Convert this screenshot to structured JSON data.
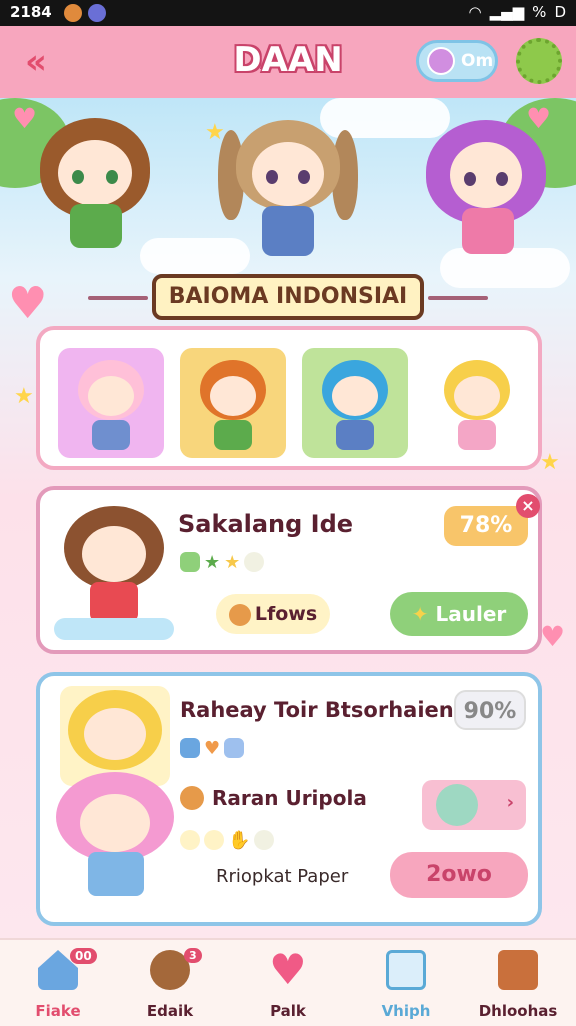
{
  "status": {
    "time": "2184",
    "right_text": "%",
    "battery": "D"
  },
  "header": {
    "title": "DAAN",
    "pill_label": "Om",
    "back_glyph": "«"
  },
  "banner": {
    "label": "BAIOMA INDONSIAI"
  },
  "card1": {
    "title": "Sakalang Ide",
    "badge": "78%",
    "close_glyph": "×",
    "btn_left": "Lfows",
    "btn_right": "Lauler"
  },
  "card2": {
    "title": "Raheay Toir Btsorhaien",
    "badge": "90%",
    "subtitle": "Raran Uripola",
    "footer": "Rriopkat Paper",
    "btn": "2owo"
  },
  "nav": {
    "items": [
      {
        "label": "Fiake",
        "badge": "00",
        "icon": "home-icon",
        "color": "#e24d6e"
      },
      {
        "label": "Edaik",
        "badge": "3",
        "icon": "bear-icon",
        "color": "#5a2030"
      },
      {
        "label": "Palk",
        "badge": "",
        "icon": "heart-icon",
        "color": "#5a2030"
      },
      {
        "label": "Vhiph",
        "badge": "",
        "icon": "gallery-icon",
        "color": "#5aa9d6"
      },
      {
        "label": "Dhloohas",
        "badge": "",
        "icon": "shop-icon",
        "color": "#5a2030"
      }
    ]
  },
  "colors": {
    "header": "#f7a6be",
    "accent": "#e24d6e",
    "blue": "#7fc3e6",
    "green": "#8ec94b"
  }
}
